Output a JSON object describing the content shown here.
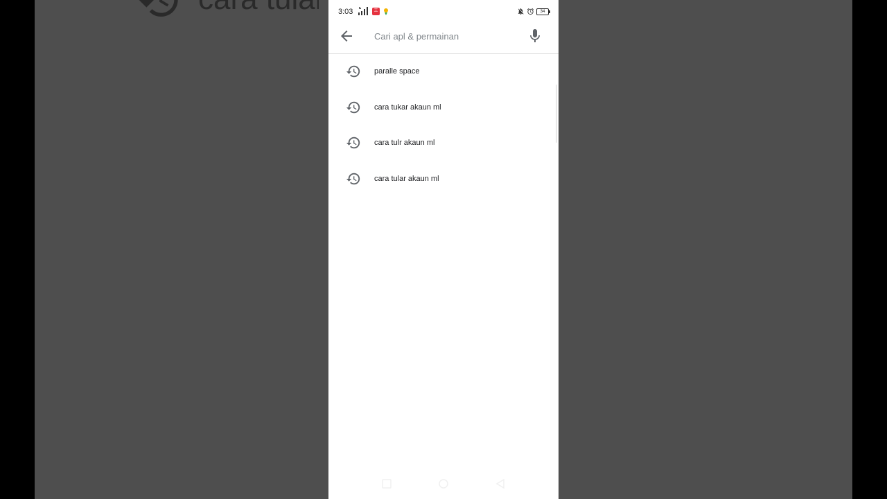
{
  "status_bar": {
    "time": "3:03",
    "app_badge": "三",
    "battery": "34"
  },
  "search": {
    "placeholder": "Cari apl & permainan",
    "value": ""
  },
  "history": [
    {
      "label": "paralle space"
    },
    {
      "label": "cara tukar akaun ml"
    },
    {
      "label": "cara tulr akaun ml"
    },
    {
      "label": "cara tular akaun ml"
    }
  ],
  "background": {
    "zoomed_text": "cara tular"
  },
  "icons": {
    "back": "arrow-back-icon",
    "mic": "mic-icon",
    "history": "history-icon",
    "nav_recents": "square-icon",
    "nav_home": "circle-icon",
    "nav_back": "triangle-icon"
  },
  "colors": {
    "icon": "#5f6368",
    "text": "#202124",
    "placeholder": "#80868b",
    "backdrop": "#4e4e4e"
  }
}
